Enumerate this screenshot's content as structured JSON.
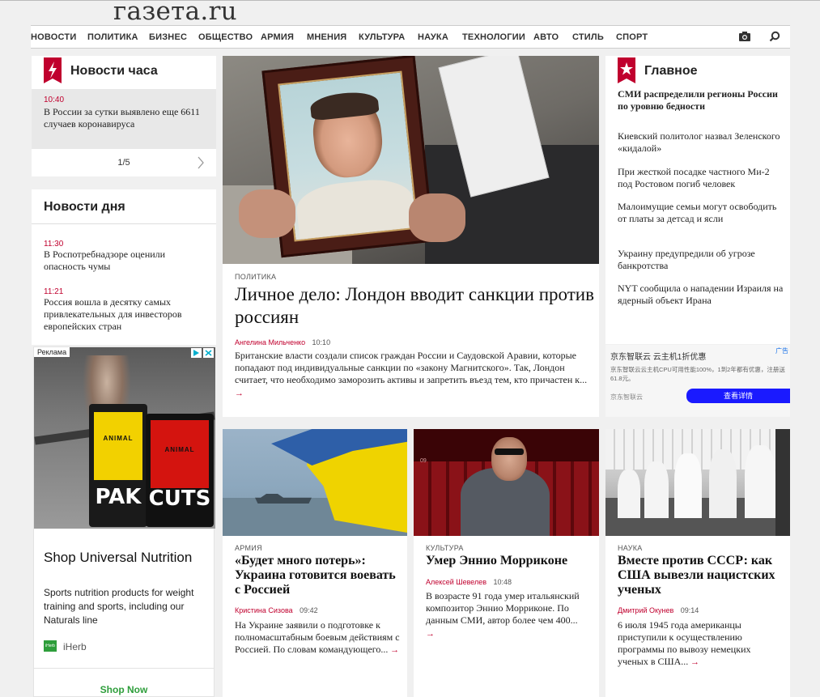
{
  "site": {
    "logo": "газета.ru"
  },
  "nav": {
    "items": [
      "НОВОСТИ",
      "ПОЛИТИКА",
      "БИЗНЕС",
      "ОБЩЕСТВО",
      "АРМИЯ",
      "МНЕНИЯ",
      "КУЛЬТУРА",
      "НАУКА",
      "ТЕХНОЛОГИИ",
      "АВТО",
      "СТИЛЬ",
      "СПОРТ"
    ]
  },
  "hour_news": {
    "title": "Новости часа",
    "time": "10:40",
    "text": "В России за сутки выявлено еще 6611 случаев коронавируса",
    "pager": "1/5"
  },
  "day_news": {
    "title": "Новости дня",
    "items": [
      {
        "time": "11:30",
        "text": "В Роспотребнадзоре оценили опасность чумы"
      },
      {
        "time": "11:21",
        "text": "Россия вошла в десятку самых привлекательных для инвесторов европейских стран"
      }
    ]
  },
  "ad_left": {
    "label": "Реклама",
    "brand_title": "Shop Universal Nutrition",
    "desc": "Sports nutrition products for weight training and sports, including our Naturals line",
    "source": "iHerb",
    "source_logo": "iHerb",
    "cta": "Shop Now",
    "pack1_word": "PAK",
    "pack2_word": "CUTS",
    "pack1_top": "ANIMAL",
    "pack2_top": "ANIMAL"
  },
  "main": {
    "tag": "ПОЛИТИКА",
    "headline": "Личное дело: Лондон вводит санкции против россиян",
    "author": "Ангелина Мильченко",
    "time": "10:10",
    "lead": "Британские власти создали список граждан России и Саудовской Аравии, которые попадают под индивидуальные санкции по «закону Магнитского». Так, Лондон считает, что необходимо заморозить активы и запретить въезд тем, кто причастен к..."
  },
  "glavnoe": {
    "title": "Главное",
    "items": [
      "СМИ распределили регионы России по уровню бедности",
      "Киевский политолог назвал Зеленского «кидалой»",
      "При жесткой посадке частного Ми-2 под Ростовом погиб человек",
      "Малоимущие семьи могут освободить от платы за детсад и ясли",
      "Украину предупредили об угрозе банкротства",
      "NYT сообщила о нападении Израиля на ядерный объект Ирана"
    ]
  },
  "ad_right": {
    "title": "京东智联云 云主机1折优惠",
    "label": "广告",
    "desc": "京东智联云云主机CPU可用性能100%，1到2年都有优惠，注册送61.8元。",
    "source": "京东智联云",
    "cta": "查看详情"
  },
  "articles": [
    {
      "tag": "АРМИЯ",
      "headline": "«Будет много потерь»: Украина готовится воевать с Россией",
      "author": "Кристина Сизова",
      "time": "09:42",
      "lead": "На Украине заявили о подготовке к полномасштабным боевым действиям с Россией. По словам командующего..."
    },
    {
      "tag": "КУЛЬТУРА",
      "headline": "Умер Эннио Морриконе",
      "author": "Алексей Шевелев",
      "time": "10:48",
      "lead": "В возрасте 91 года умер итальянский композитор Эннио Морриконе. По данным СМИ, автор более чем 400...",
      "img_caption": "09"
    },
    {
      "tag": "НАУКА",
      "headline": "Вместе против СССР: как США вывезли нацистских ученых",
      "author": "Дмитрий Окунев",
      "time": "09:14",
      "lead": "6 июля 1945 года американцы приступили к осуществлению программы по вывозу немецких ученых в США..."
    }
  ],
  "colors": {
    "accent": "#c0002e",
    "ad_button": "#1a1aff",
    "ad_green": "#2e9e3b"
  }
}
